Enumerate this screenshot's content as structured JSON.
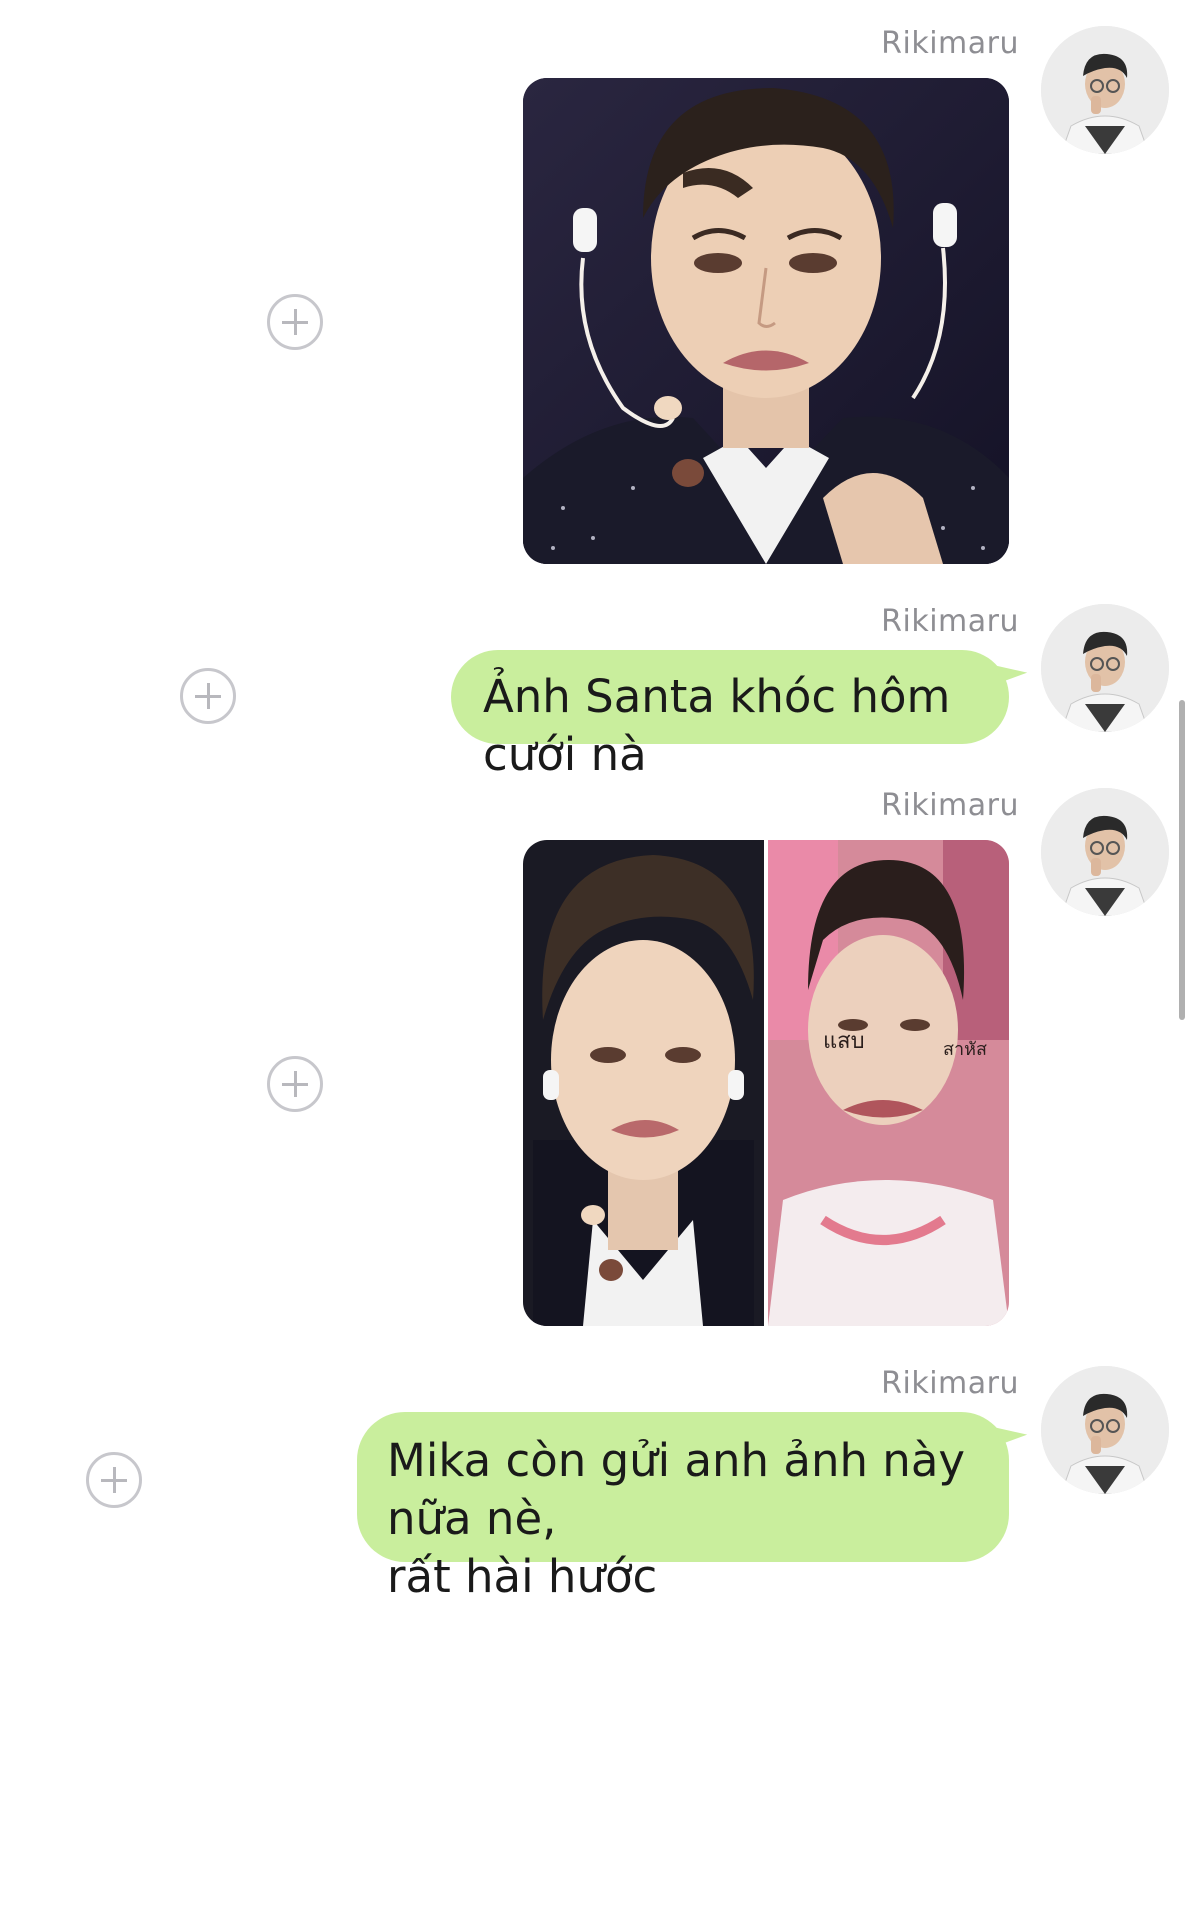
{
  "messages": [
    {
      "type": "image",
      "sender": "Rikimaru",
      "image_label": "Crying performer photo"
    },
    {
      "type": "text",
      "sender": "Rikimaru",
      "text": "Ảnh Santa khóc hôm cưới nà"
    },
    {
      "type": "image",
      "sender": "Rikimaru",
      "image_label": "Side-by-side crying comparison photo",
      "overlay_text_left": "แสบ",
      "overlay_text_right": "สาหัส"
    },
    {
      "type": "text",
      "sender": "Rikimaru",
      "text": "Mika còn gửi anh ảnh này nữa nè,\nrất hài hước"
    }
  ],
  "colors": {
    "bubble": "#c9ee9d",
    "sender_name": "#8e8e93",
    "plus_button": "#c7c7cc"
  },
  "icons": {
    "share_button": "plus-circle-icon",
    "avatar": "user-avatar"
  }
}
